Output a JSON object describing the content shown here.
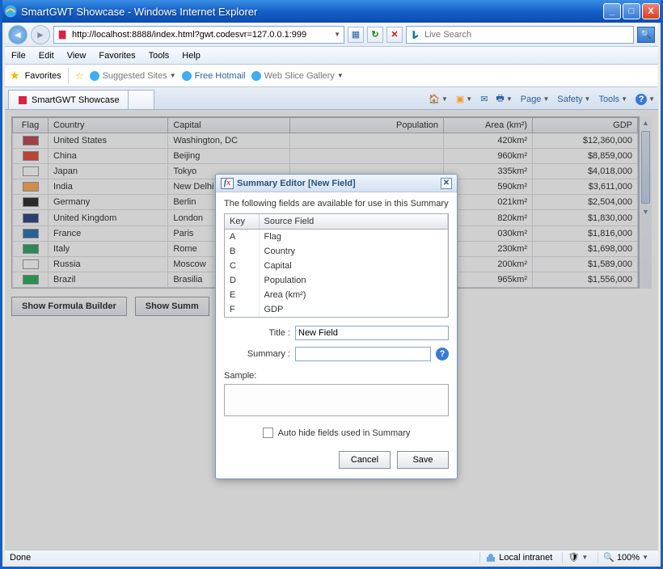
{
  "titlebar": {
    "title": "SmartGWT Showcase - Windows Internet Explorer"
  },
  "window_controls": {
    "min": "_",
    "max": "□",
    "close": "X"
  },
  "address_bar": {
    "value": "http://localhost:8888/index.html?gwt.codesvr=127.0.0.1:999"
  },
  "search_bar": {
    "placeholder": "Live Search"
  },
  "menu_bar": [
    "File",
    "Edit",
    "View",
    "Favorites",
    "Tools",
    "Help"
  ],
  "favorites_bar": {
    "label": "Favorites",
    "links": [
      "Suggested Sites",
      "Free Hotmail",
      "Web Slice Gallery"
    ]
  },
  "tab": {
    "title": "SmartGWT Showcase"
  },
  "command_bar": [
    "Page",
    "Safety",
    "Tools"
  ],
  "overflow_chevron": "»",
  "grid": {
    "columns": [
      "Flag",
      "Country",
      "Capital",
      "Population",
      "Area (km²)",
      "GDP"
    ],
    "rows": [
      {
        "flag": "#b22234",
        "country": "United States",
        "capital": "Washington, DC",
        "pop": "",
        "area": "420km²",
        "gdp": "$12,360,000"
      },
      {
        "flag": "#de2910",
        "country": "China",
        "capital": "Beijing",
        "pop": "",
        "area": "960km²",
        "gdp": "$8,859,000"
      },
      {
        "flag": "#ffffff",
        "country": "Japan",
        "capital": "Tokyo",
        "pop": "",
        "area": "335km²",
        "gdp": "$4,018,000"
      },
      {
        "flag": "#ff9933",
        "country": "India",
        "capital": "New Delhi",
        "pop": "",
        "area": "590km²",
        "gdp": "$3,611,000"
      },
      {
        "flag": "#000000",
        "country": "Germany",
        "capital": "Berlin",
        "pop": "",
        "area": "021km²",
        "gdp": "$2,504,000"
      },
      {
        "flag": "#012169",
        "country": "United Kingdom",
        "capital": "London",
        "pop": "",
        "area": "820km²",
        "gdp": "$1,830,000"
      },
      {
        "flag": "#0055a4",
        "country": "France",
        "capital": "Paris",
        "pop": "",
        "area": "030km²",
        "gdp": "$1,816,000"
      },
      {
        "flag": "#009246",
        "country": "Italy",
        "capital": "Rome",
        "pop": "",
        "area": "230km²",
        "gdp": "$1,698,000"
      },
      {
        "flag": "#ffffff",
        "country": "Russia",
        "capital": "Moscow",
        "pop": "",
        "area": "200km²",
        "gdp": "$1,589,000"
      },
      {
        "flag": "#009b3a",
        "country": "Brazil",
        "capital": "Brasilia",
        "pop": "",
        "area": "965km²",
        "gdp": "$1,556,000"
      }
    ]
  },
  "buttons": {
    "formula": "Show Formula Builder",
    "summary": "Show Summ"
  },
  "dialog": {
    "title": "Summary Editor [New Field]",
    "intro": "The following fields are available for use in this Summary",
    "cols": {
      "key": "Key",
      "source": "Source Field"
    },
    "rows": [
      {
        "key": "A",
        "source": "Flag"
      },
      {
        "key": "B",
        "source": "Country"
      },
      {
        "key": "C",
        "source": "Capital"
      },
      {
        "key": "D",
        "source": "Population"
      },
      {
        "key": "E",
        "source": "Area (km²)"
      },
      {
        "key": "F",
        "source": "GDP"
      }
    ],
    "title_label": "Title :",
    "title_value": "New Field",
    "summary_label": "Summary :",
    "summary_value": "",
    "sample_label": "Sample:",
    "autohide_label": "Auto hide fields used in Summary",
    "cancel": "Cancel",
    "save": "Save"
  },
  "status_bar": {
    "done": "Done",
    "zone": "Local intranet",
    "zoom": "100%"
  }
}
